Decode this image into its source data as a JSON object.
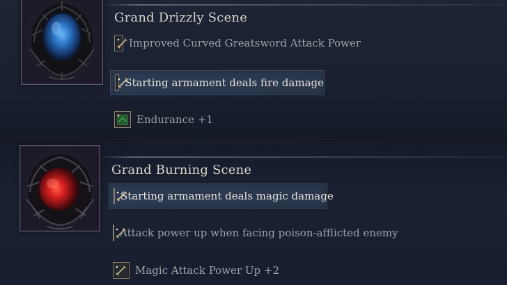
{
  "relics": [
    {
      "name": "Grand Drizzly Scene",
      "color": "blue",
      "effects": [
        {
          "text": "Improved Curved Greatsword Attack Power",
          "icon": "sword-icon",
          "selected": false
        },
        {
          "text": "Starting armament deals fire damage",
          "icon": "sword-icon",
          "selected": true
        },
        {
          "text": "Endurance +1",
          "icon": "green-stat-icon",
          "selected": false
        }
      ]
    },
    {
      "name": "Grand Burning Scene",
      "color": "red",
      "effects": [
        {
          "text": "Starting armament deals magic damage",
          "icon": "sword-icon",
          "selected": true
        },
        {
          "text": "Attack power up when facing poison-afflicted enemy",
          "icon": "sword-icon",
          "selected": false
        },
        {
          "text": "Magic Attack Power Up +2",
          "icon": "sword-icon",
          "selected": false
        }
      ]
    }
  ],
  "colors": {
    "background": "#1c2333",
    "selected_highlight": "#2d3a52",
    "blue_gem": "#3a8ad8",
    "red_gem": "#e0302a",
    "stat_green": "#2e7a3a"
  }
}
